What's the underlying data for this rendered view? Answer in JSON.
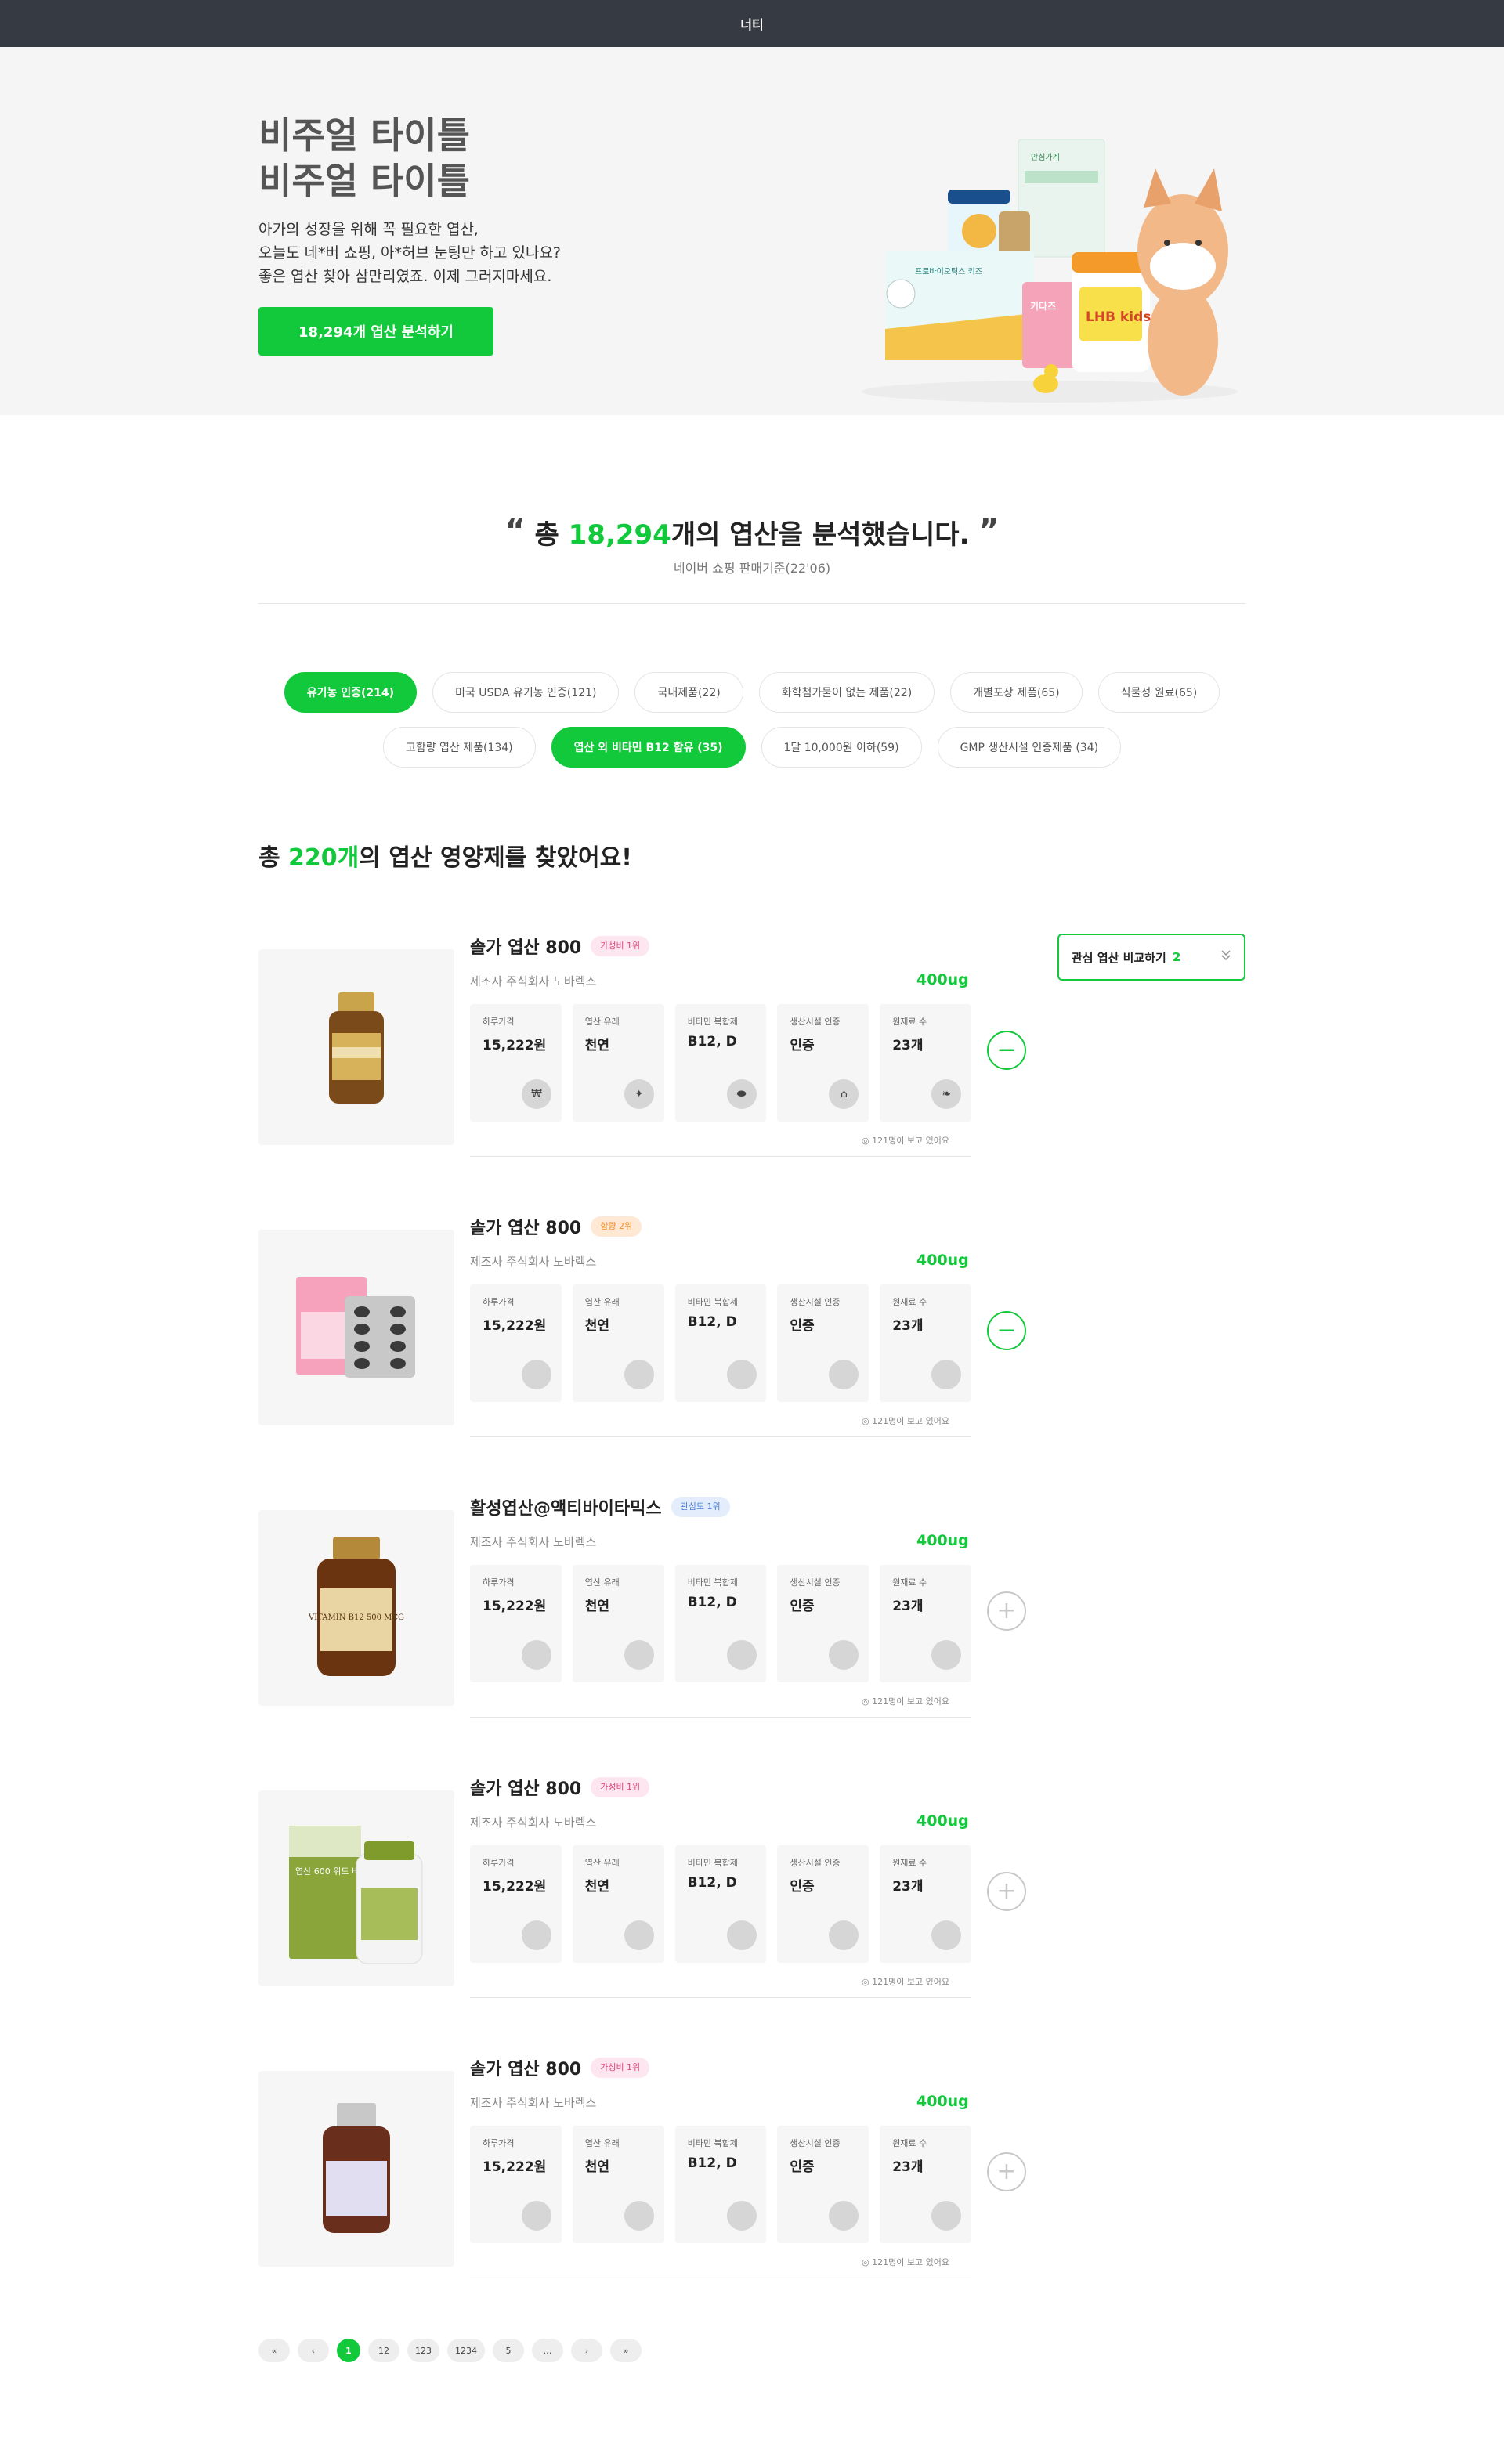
{
  "header": {
    "title": "너티"
  },
  "hero": {
    "title_line1": "비주얼 타이틀",
    "title_line2": "비주얼 타이틀",
    "desc_line1": "아가의 성장을 위해 꼭 필요한 엽산,",
    "desc_line2": "오늘도 네*버 쇼핑, 아*허브 눈팅만 하고 있나요?",
    "desc_line3": "좋은 엽산 찾아 삼만리였죠. 이제 그러지마세요.",
    "cta_label": "18,294개 엽산 분석하기",
    "image_texts": {
      "box_top": "안심가계",
      "box_probiotics": "프로바이오틱스 키즈",
      "jar_label": "LHB kids",
      "can_label": "키다즈"
    }
  },
  "summary": {
    "prefix": "총 ",
    "count": "18,294",
    "suffix": "개의 엽산을 분석했습니다.",
    "open_mark": "“",
    "close_mark": "”",
    "subtitle": "네이버 쇼핑 판매기준(22'06)"
  },
  "filters": {
    "row1": [
      {
        "label": "유기농 인증(214)",
        "active": true
      },
      {
        "label": "미국 USDA 유기농 인증(121)",
        "active": false
      },
      {
        "label": "국내제품(22)",
        "active": false
      },
      {
        "label": "화학첨가물이 없는 제품(22)",
        "active": false
      },
      {
        "label": "개별포장 제품(65)",
        "active": false
      },
      {
        "label": "식물성 원료(65)",
        "active": false
      }
    ],
    "row2": [
      {
        "label": "고함량 엽산 제품(134)",
        "active": false
      },
      {
        "label": "엽산 외 비타민 B12 함유 (35)",
        "active": true
      },
      {
        "label": "1달 10,000원 이하(59)",
        "active": false
      },
      {
        "label": "GMP 생산시설 인증제품 (34)",
        "active": false
      }
    ]
  },
  "results": {
    "prefix": "총 ",
    "count": "220개",
    "suffix": "의 엽산 영양제를 찾았어요!"
  },
  "compare": {
    "label": "관심 엽산 비교하기",
    "count": "2",
    "icon": "chevron-double-down-icon"
  },
  "cell_labels": {
    "price": "하루가격",
    "origin": "엽산 유래",
    "vitamin": "비타민 복합제",
    "facility": "생산시설 인증",
    "ingredients": "원재료 수"
  },
  "products": [
    {
      "name": "솔가 엽산 800",
      "badge": "가성비 1위",
      "badge_color": "#e0457b",
      "maker": "제조사 주식회사 노바렉스",
      "dose": "400ug",
      "price": "15,222원",
      "origin": "천연",
      "vitamin": "B12, D",
      "facility": "인증",
      "ingredients": "23개",
      "views": "121명이 보고 있어요",
      "in_compare": true,
      "show_icons": true,
      "image": "amber-bottle-gold-cap"
    },
    {
      "name": "솔가 엽산 800",
      "badge": "함량 2위",
      "badge_color": "#f08a24",
      "maker": "제조사 주식회사 노바렉스",
      "dose": "400ug",
      "price": "15,222원",
      "origin": "천연",
      "vitamin": "B12, D",
      "facility": "인증",
      "ingredients": "23개",
      "views": "121명이 보고 있어요",
      "in_compare": true,
      "show_icons": false,
      "image": "pink-box-blister"
    },
    {
      "name": "활성엽산@액티바이타믹스",
      "badge": "관심도 1위",
      "badge_color": "#4a7fd4",
      "maker": "제조사 주식회사 노바렉스",
      "dose": "400ug",
      "price": "15,222원",
      "origin": "천연",
      "vitamin": "B12, D",
      "facility": "인증",
      "ingredients": "23개",
      "views": "121명이 보고 있어요",
      "in_compare": false,
      "show_icons": false,
      "image": "vitamin-b12-bottle",
      "image_label": "VITAMIN B12 500 MCG"
    },
    {
      "name": "솔가 엽산 800",
      "badge": "가성비 1위",
      "badge_color": "#e0457b",
      "maker": "제조사 주식회사 노바렉스",
      "dose": "400ug",
      "price": "15,222원",
      "origin": "천연",
      "vitamin": "B12, D",
      "facility": "인증",
      "ingredients": "23개",
      "views": "121명이 보고 있어요",
      "in_compare": false,
      "show_icons": false,
      "image": "green-box-white-bottle",
      "image_label": "엽산 600 위드 비타민D"
    },
    {
      "name": "솔가 엽산 800",
      "badge": "가성비 1위",
      "badge_color": "#e0457b",
      "maker": "제조사 주식회사 노바렉스",
      "dose": "400ug",
      "price": "15,222원",
      "origin": "천연",
      "vitamin": "B12, D",
      "facility": "인증",
      "ingredients": "23개",
      "views": "121명이 보고 있어요",
      "in_compare": false,
      "show_icons": false,
      "image": "brown-bottle-silver-cap"
    }
  ],
  "cell_icons": [
    "won-icon",
    "leaf-icon",
    "pill-icon",
    "factory-icon",
    "ingredient-icon"
  ],
  "pagination": [
    {
      "label": "«",
      "active": false
    },
    {
      "label": "‹",
      "active": false
    },
    {
      "label": "1",
      "active": true
    },
    {
      "label": "12",
      "active": false
    },
    {
      "label": "123",
      "active": false
    },
    {
      "label": "1234",
      "active": false
    },
    {
      "label": "5",
      "active": false
    },
    {
      "label": "…",
      "active": false
    },
    {
      "label": "›",
      "active": false
    },
    {
      "label": "»",
      "active": false
    }
  ],
  "colors": {
    "brand": "#12c93b",
    "topbar": "#363b43",
    "hero_bg": "#f5f5f5",
    "cell_bg": "#f6f6f6"
  }
}
